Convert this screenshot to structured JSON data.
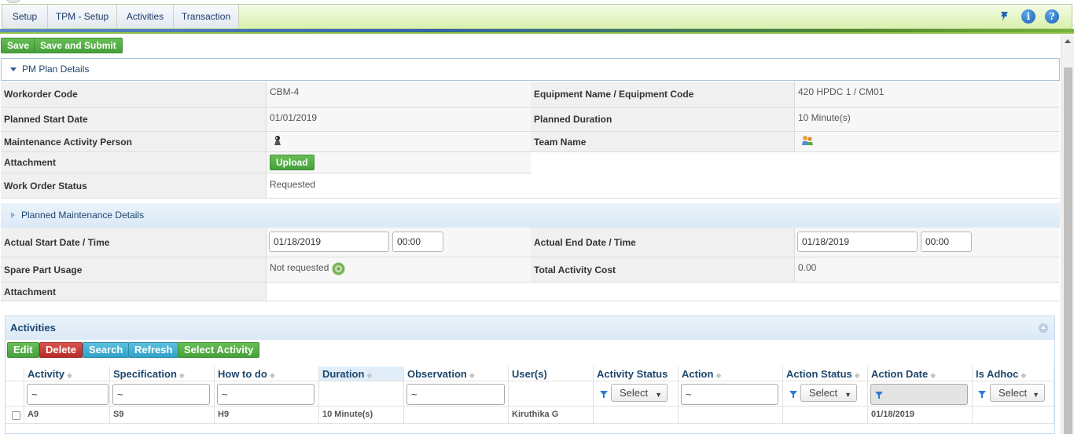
{
  "menu": {
    "items": [
      {
        "label": "Setup"
      },
      {
        "label": "TPM - Setup"
      },
      {
        "label": "Activities"
      },
      {
        "label": "Transaction"
      }
    ],
    "right_icons": [
      "pin-icon",
      "info-icon",
      "help-icon"
    ],
    "info_glyph": "i",
    "help_glyph": "?"
  },
  "toolbar": {
    "save_label": "Save",
    "save_submit_label": "Save and Submit"
  },
  "pm_plan": {
    "title": "PM Plan Details",
    "workorder_code_label": "Workorder Code",
    "workorder_code": "CBM-4",
    "equipment_label": "Equipment Name / Equipment Code",
    "equipment": "420 HPDC 1 / CM01",
    "planned_start_label": "Planned Start Date",
    "planned_start": "01/01/2019",
    "planned_duration_label": "Planned Duration",
    "planned_duration": "10 Minute(s)",
    "maintenance_person_label": "Maintenance Activity Person",
    "team_name_label": "Team Name",
    "attachment_label": "Attachment",
    "upload_label": "Upload",
    "work_order_status_label": "Work Order Status",
    "work_order_status": "Requested"
  },
  "planned_maintenance": {
    "title": "Planned Maintenance Details",
    "actual_start_label": "Actual Start Date / Time",
    "actual_start_date": "01/18/2019",
    "actual_start_time": "00:00",
    "actual_end_label": "Actual End Date / Time",
    "actual_end_date": "01/18/2019",
    "actual_end_time": "00:00",
    "spare_part_label": "Spare Part Usage",
    "spare_part_value": "Not requested",
    "total_cost_label": "Total Activity Cost",
    "total_cost": "0.00",
    "attachment_label": "Attachment"
  },
  "activities": {
    "title": "Activities",
    "buttons": {
      "edit": "Edit",
      "delete": "Delete",
      "search": "Search",
      "refresh": "Refresh",
      "select_activity": "Select Activity"
    },
    "columns": [
      {
        "label": "Activity"
      },
      {
        "label": "Specification"
      },
      {
        "label": "How to do"
      },
      {
        "label": "Duration"
      },
      {
        "label": "Observation"
      },
      {
        "label": "User(s)"
      },
      {
        "label": "Activity Status"
      },
      {
        "label": "Action"
      },
      {
        "label": "Action Status"
      },
      {
        "label": "Action Date"
      },
      {
        "label": "Is Adhoc"
      }
    ],
    "filters": {
      "text_placeholder": "~",
      "select_label": "Select"
    },
    "rows": [
      {
        "activity": "A9",
        "specification": "S9",
        "how_to_do": "H9",
        "duration": "10 Minute(s)",
        "observation": "",
        "users": "Kiruthika G",
        "activity_status": "",
        "action": "",
        "action_status": "",
        "action_date": "01/18/2019",
        "is_adhoc": ""
      }
    ]
  }
}
